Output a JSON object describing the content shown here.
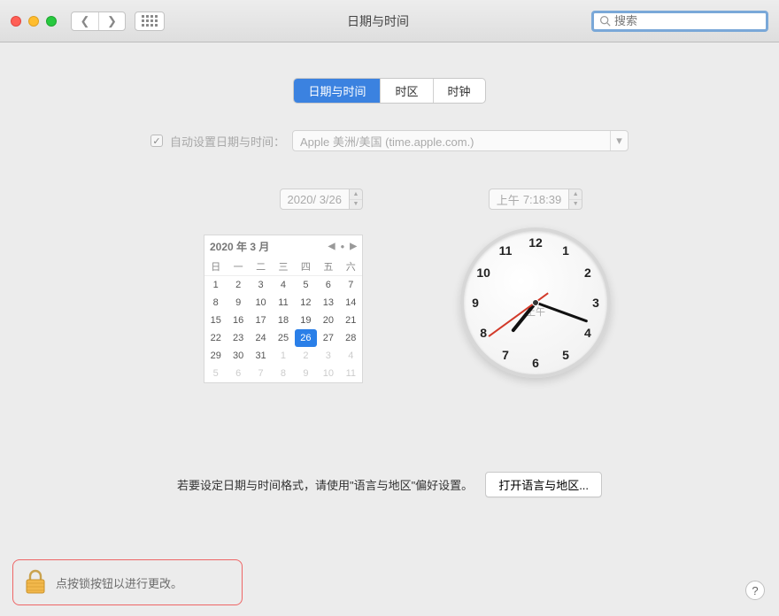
{
  "window": {
    "title": "日期与时间",
    "search_placeholder": "搜索"
  },
  "tabs": {
    "datetime": "日期与时间",
    "timezone": "时区",
    "clock": "时钟"
  },
  "auto": {
    "label": "自动设置日期与时间：",
    "server": "Apple 美洲/美国 (time.apple.com.)"
  },
  "date_field": "2020/  3/26",
  "time_field_ampm": "上午",
  "time_field_value": "7:18:39",
  "calendar": {
    "title": "2020 年 3 月",
    "weekdays": [
      "日",
      "一",
      "二",
      "三",
      "四",
      "五",
      "六"
    ],
    "days": [
      {
        "n": "1"
      },
      {
        "n": "2"
      },
      {
        "n": "3"
      },
      {
        "n": "4"
      },
      {
        "n": "5"
      },
      {
        "n": "6"
      },
      {
        "n": "7"
      },
      {
        "n": "8"
      },
      {
        "n": "9"
      },
      {
        "n": "10"
      },
      {
        "n": "11"
      },
      {
        "n": "12"
      },
      {
        "n": "13"
      },
      {
        "n": "14"
      },
      {
        "n": "15"
      },
      {
        "n": "16"
      },
      {
        "n": "17"
      },
      {
        "n": "18"
      },
      {
        "n": "19"
      },
      {
        "n": "20"
      },
      {
        "n": "21"
      },
      {
        "n": "22"
      },
      {
        "n": "23"
      },
      {
        "n": "24"
      },
      {
        "n": "25"
      },
      {
        "n": "26",
        "sel": true
      },
      {
        "n": "27"
      },
      {
        "n": "28"
      },
      {
        "n": "29"
      },
      {
        "n": "30"
      },
      {
        "n": "31"
      },
      {
        "n": "1",
        "dim": true
      },
      {
        "n": "2",
        "dim": true
      },
      {
        "n": "3",
        "dim": true
      },
      {
        "n": "4",
        "dim": true
      },
      {
        "n": "5",
        "dim": true
      },
      {
        "n": "6",
        "dim": true
      },
      {
        "n": "7",
        "dim": true
      },
      {
        "n": "8",
        "dim": true
      },
      {
        "n": "9",
        "dim": true
      },
      {
        "n": "10",
        "dim": true
      },
      {
        "n": "11",
        "dim": true
      }
    ]
  },
  "clock": {
    "ampm": "上午",
    "numbers": [
      "12",
      "1",
      "2",
      "3",
      "4",
      "5",
      "6",
      "7",
      "8",
      "9",
      "10",
      "11"
    ],
    "hour_angle": 219,
    "minute_angle": 110,
    "second_angle": 234
  },
  "format_hint": "若要设定日期与时间格式，请使用\"语言与地区\"偏好设置。",
  "open_region_btn": "打开语言与地区...",
  "lock_hint": "点按锁按钮以进行更改。",
  "help": "?"
}
